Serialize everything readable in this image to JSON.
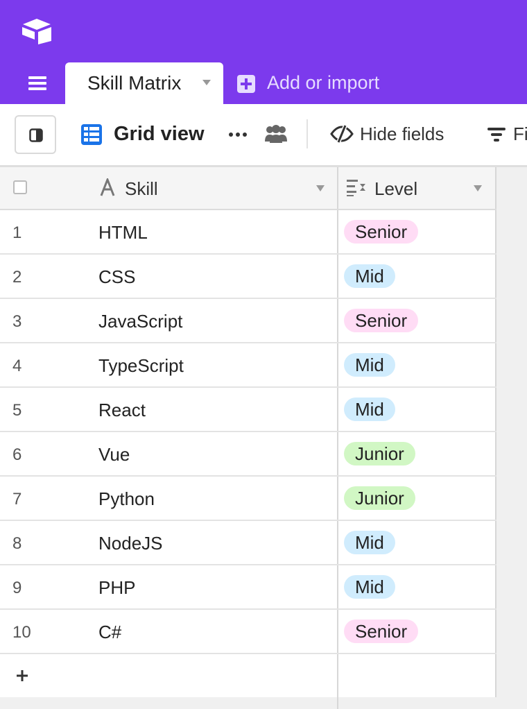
{
  "header": {
    "logo_icon": "airtable-logo-icon",
    "menu_icon": "hamburger-menu-icon",
    "active_tab": {
      "label": "Skill Matrix",
      "caret_icon": "caret-down-icon"
    },
    "add_import": {
      "label": "Add or import",
      "icon": "plus-square-icon"
    },
    "colors": {
      "brand": "#7c3aed"
    }
  },
  "toolbar": {
    "sidebar_toggle_icon": "sidebar-toggle-icon",
    "view": {
      "icon": "grid-view-icon",
      "name": "Grid view"
    },
    "more_icon": "more-icon",
    "collaborators_icon": "people-icon",
    "hide_fields": {
      "icon": "eye-slash-icon",
      "label": "Hide fields"
    },
    "filter": {
      "icon": "filter-icon",
      "label": "Fi"
    }
  },
  "grid": {
    "columns": [
      {
        "name": "Skill",
        "icon": "text-field-icon"
      },
      {
        "name": "Level",
        "icon": "single-select-icon"
      }
    ],
    "rows": [
      {
        "num": "1",
        "skill": "HTML",
        "level": "Senior"
      },
      {
        "num": "2",
        "skill": "CSS",
        "level": "Mid"
      },
      {
        "num": "3",
        "skill": "JavaScript",
        "level": "Senior"
      },
      {
        "num": "4",
        "skill": "TypeScript",
        "level": "Mid"
      },
      {
        "num": "5",
        "skill": "React",
        "level": "Mid"
      },
      {
        "num": "6",
        "skill": "Vue",
        "level": "Junior"
      },
      {
        "num": "7",
        "skill": "Python",
        "level": "Junior"
      },
      {
        "num": "8",
        "skill": "NodeJS",
        "level": "Mid"
      },
      {
        "num": "9",
        "skill": "PHP",
        "level": "Mid"
      },
      {
        "num": "10",
        "skill": "C#",
        "level": "Senior"
      }
    ],
    "level_colors": {
      "Senior": "#ffdcf5",
      "Mid": "#d0ecfd",
      "Junior": "#d1f7c4"
    },
    "add_row_icon": "plus-icon"
  }
}
